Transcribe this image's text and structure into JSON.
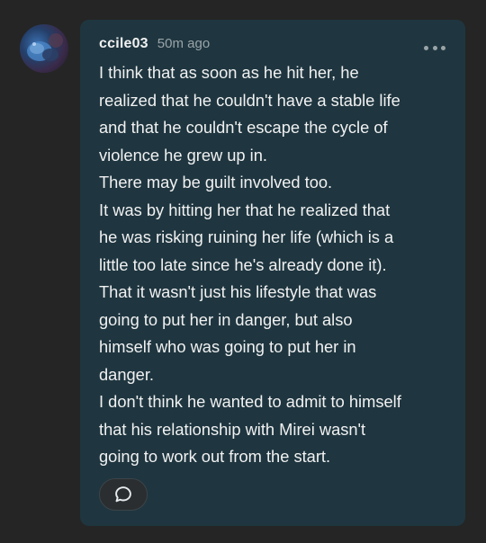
{
  "comment": {
    "username": "ccile03",
    "timestamp": "50m ago",
    "more_icon": "ellipsis-icon",
    "lines": [
      "I think that as soon as he hit her, he",
      "realized that he couldn't have a stable life",
      "and that he couldn't escape the cycle of",
      "violence he grew up in.",
      "There may be guilt involved too.",
      "It was by hitting her that he realized that",
      "he was risking ruining her life (which is a",
      "little too late since he's already done it).",
      "That it wasn't just his lifestyle that was",
      "going to put her in danger, but also",
      "himself who was going to put her in",
      "danger.",
      "I don't think he wanted to admit to himself",
      "that his relationship with Mirei wasn't",
      "going to work out from the start."
    ],
    "reply_icon": "speech-bubble-icon"
  },
  "colors": {
    "background": "#252525",
    "card": "#1f3640",
    "text": "#f1f1f1",
    "muted": "#9aa4a8"
  }
}
